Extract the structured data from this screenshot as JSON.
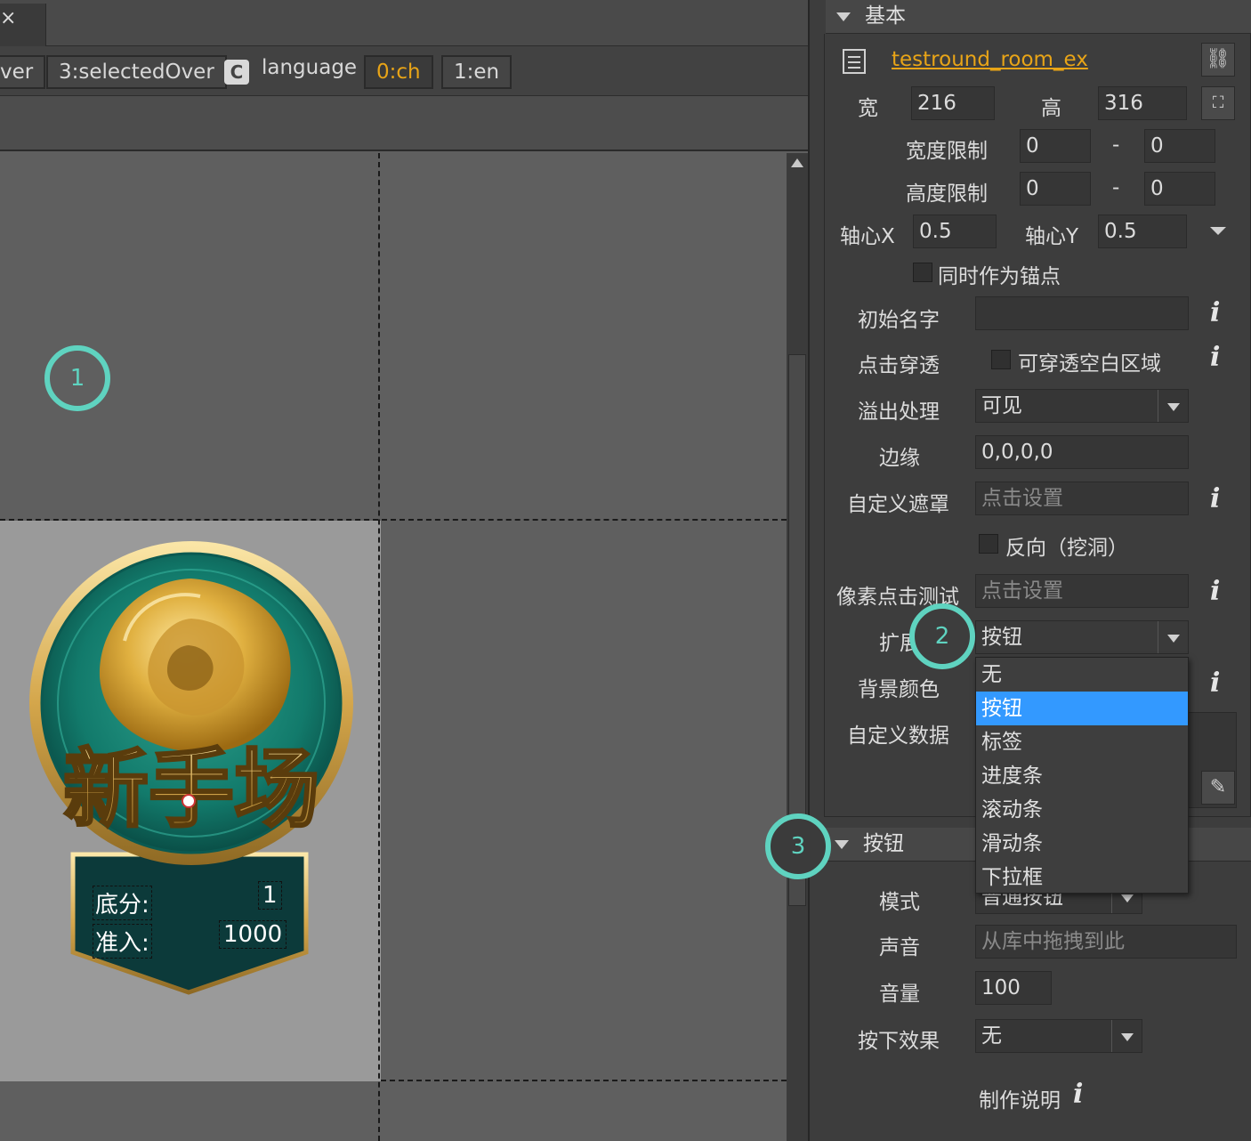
{
  "topbar": {
    "tab_glyph": "×"
  },
  "statebar": {
    "chips": [
      "ver",
      "3:selectedOver"
    ],
    "lang_icon": "C",
    "lang_label": "language",
    "lang_options": [
      "0:ch",
      "1:en"
    ]
  },
  "callouts": [
    "1",
    "2",
    "3"
  ],
  "badge": {
    "title": "新手场",
    "base_label": "底分:",
    "base_value": "1",
    "entry_label": "准入:",
    "entry_value": "1000"
  },
  "panel": {
    "basic": {
      "header": "基本",
      "name": "testround_room_ex",
      "width_label": "宽",
      "width": "216",
      "height_label": "高",
      "height": "316",
      "width_limit_label": "宽度限制",
      "width_min": "0",
      "width_max": "0",
      "height_limit_label": "高度限制",
      "height_min": "0",
      "height_max": "0",
      "dash": "-",
      "pivot_x_label": "轴心X",
      "pivot_x": "0.5",
      "pivot_y_label": "轴心Y",
      "pivot_y": "0.5",
      "anchor_label": "同时作为锚点",
      "init_name_label": "初始名字",
      "init_name": "",
      "click_through_label": "点击穿透",
      "click_through_option": "可穿透空白区域",
      "overflow_label": "溢出处理",
      "overflow_value": "可见",
      "margin_label": "边缘",
      "margin_value": "0,0,0,0",
      "mask_label": "自定义遮罩",
      "mask_placeholder": "点击设置",
      "reverse_label": "反向（挖洞）",
      "pixel_hit_label": "像素点击测试",
      "pixel_hit_placeholder": "点击设置",
      "extend_label": "扩展",
      "extend_value": "按钮",
      "bg_color_label": "背景颜色",
      "custom_data_label": "自定义数据"
    },
    "extend_menu": [
      "无",
      "按钮",
      "标签",
      "进度条",
      "滚动条",
      "滑动条",
      "下拉框"
    ],
    "extend_menu_selected": "按钮",
    "button": {
      "header": "按钮",
      "mode_label": "模式",
      "mode_value": "普通按钮",
      "sound_label": "声音",
      "sound_placeholder": "从库中拖拽到此",
      "volume_label": "音量",
      "volume_value": "100",
      "press_effect_label": "按下效果",
      "press_effect_value": "无",
      "docs_label": "制作说明"
    },
    "info_glyph": "i"
  },
  "colors": {
    "accent_orange": "#e8a417",
    "callout": "#5fd3c0",
    "menu_highlight": "#3399ff"
  }
}
